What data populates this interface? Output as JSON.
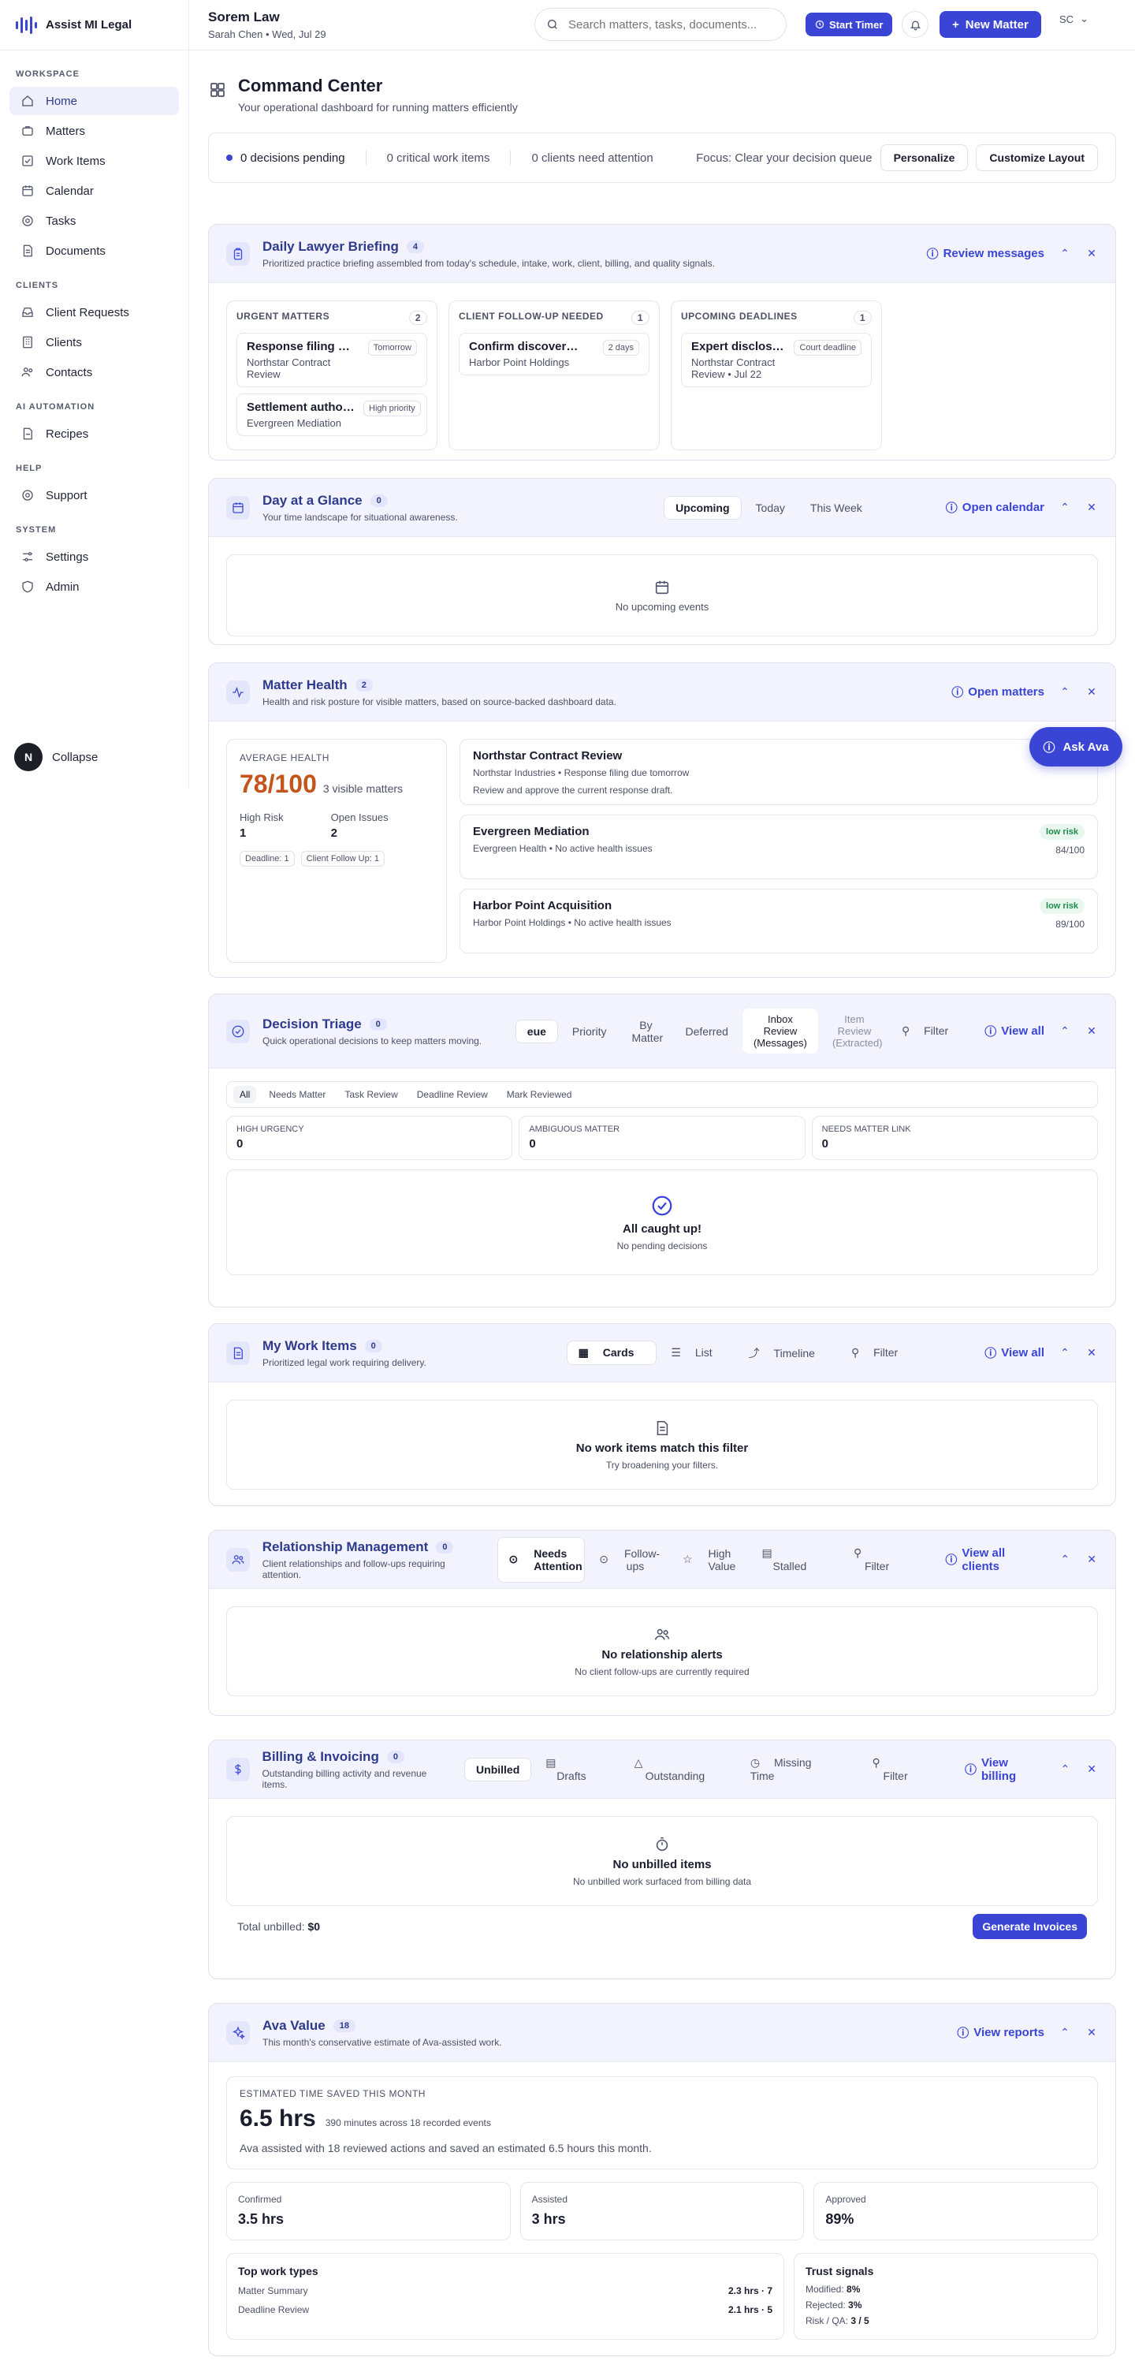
{
  "app": {
    "name": "Assist MI Legal",
    "firm": "Sorem Law",
    "user_line": "Sarah Chen • Wed, Jul 29",
    "initials": "SC"
  },
  "sidebar": {
    "sections": [
      {
        "label": "WORKSPACE",
        "items": [
          {
            "label": "Home",
            "icon": "home-icon"
          },
          {
            "label": "Matters",
            "icon": "briefcase-icon"
          },
          {
            "label": "Work Items",
            "icon": "checkbox-icon"
          },
          {
            "label": "Calendar",
            "icon": "calendar-icon"
          },
          {
            "label": "Tasks",
            "icon": "target-icon"
          },
          {
            "label": "Documents",
            "icon": "document-icon"
          }
        ]
      },
      {
        "label": "CLIENTS",
        "items": [
          {
            "label": "Client Requests",
            "icon": "inbox-icon"
          },
          {
            "label": "Clients",
            "icon": "building-icon"
          },
          {
            "label": "Contacts",
            "icon": "users-icon"
          }
        ]
      },
      {
        "label": "AI AUTOMATION",
        "items": [
          {
            "label": "Recipes",
            "icon": "recipe-icon"
          }
        ]
      },
      {
        "label": "HELP",
        "items": [
          {
            "label": "Support",
            "icon": "lifebuoy-icon"
          }
        ]
      },
      {
        "label": "SYSTEM",
        "items": [
          {
            "label": "Settings",
            "icon": "sliders-icon"
          },
          {
            "label": "Admin",
            "icon": "shield-icon"
          }
        ]
      }
    ],
    "collapse": "Collapse",
    "avatar": "N"
  },
  "topbar": {
    "search_placeholder": "Search matters, tasks, documents...",
    "timer": "Start Timer",
    "new_matter": "New Matter"
  },
  "command": {
    "title": "Command Center",
    "subtitle": "Your operational dashboard for running matters efficiently"
  },
  "status": {
    "decisions": "0 decisions pending",
    "critical": "0 critical work items",
    "clients": "0 clients need attention",
    "focus": "Focus: Clear your decision queue",
    "personalize": "Personalize",
    "customize": "Customize Layout"
  },
  "briefing": {
    "title": "Daily Lawyer Briefing",
    "count": "4",
    "subtitle": "Prioritized practice briefing assembled from today's schedule, intake, work, client, billing, and quality signals.",
    "action": "Review messages",
    "columns": [
      {
        "label": "URGENT MATTERS",
        "count": "2",
        "items": [
          {
            "title": "Response filing due tomorrow",
            "sub": "Northstar Contract Review",
            "tag": "Tomorrow"
          },
          {
            "title": "Settlement authority",
            "sub": "Evergreen Mediation",
            "tag": "High priority"
          }
        ]
      },
      {
        "label": "CLIENT FOLLOW-UP NEEDED",
        "count": "1",
        "items": [
          {
            "title": "Confirm discovery schedule",
            "sub": "Harbor Point Holdings",
            "tag": "2 days"
          }
        ]
      },
      {
        "label": "UPCOMING DEADLINES",
        "count": "1",
        "items": [
          {
            "title": "Expert disclosure",
            "sub": "Northstar Contract Review • Jul 22",
            "tag": "Court deadline"
          }
        ]
      }
    ]
  },
  "glance": {
    "title": "Day at a Glance",
    "count": "0",
    "subtitle": "Your time landscape for situational awareness.",
    "tabs": [
      "Upcoming",
      "Today",
      "This Week"
    ],
    "action": "Open calendar",
    "empty": "No upcoming events"
  },
  "health": {
    "title": "Matter Health",
    "count": "2",
    "subtitle": "Health and risk posture for visible matters, based on source-backed dashboard data.",
    "action": "Open matters",
    "avg_label": "AVERAGE HEALTH",
    "score": "78/100",
    "visible": "3 visible matters",
    "high_risk_label": "High Risk",
    "high_risk": "1",
    "open_issues_label": "Open Issues",
    "open_issues": "2",
    "chip1": "Deadline: 1",
    "chip2": "Client Follow Up: 1",
    "matters": [
      {
        "title": "Northstar Contract Review",
        "sub": "Northstar Industries • Response filing due tomorrow",
        "note": "Review and approve the current response draft."
      },
      {
        "title": "Evergreen Mediation",
        "sub": "Evergreen Health • No active health issues",
        "risk": "low risk",
        "score": "84/100"
      },
      {
        "title": "Harbor Point Acquisition",
        "sub": "Harbor Point Holdings • No active health issues",
        "risk": "low risk",
        "score": "89/100"
      }
    ]
  },
  "ask_ava": "Ask Ava",
  "triage": {
    "title": "Decision Triage",
    "count": "0",
    "subtitle": "Quick operational decisions to keep matters moving.",
    "tabs": [
      "eue",
      "Priority",
      "By Matter",
      "Deferred",
      "Inbox Review (Messages)",
      "Item Review (Extracted)"
    ],
    "filter": "Filter",
    "action": "View all",
    "subtabs": [
      "All",
      "Needs Matter",
      "Task Review",
      "Deadline Review",
      "Mark Reviewed"
    ],
    "stats": [
      {
        "label": "HIGH URGENCY",
        "value": "0"
      },
      {
        "label": "AMBIGUOUS MATTER",
        "value": "0"
      },
      {
        "label": "NEEDS MATTER LINK",
        "value": "0"
      }
    ],
    "empty_title": "All caught up!",
    "empty_sub": "No pending decisions"
  },
  "work": {
    "title": "My Work Items",
    "count": "0",
    "subtitle": "Prioritized legal work requiring delivery.",
    "tabs": [
      "Cards",
      "List",
      "Timeline"
    ],
    "filter": "Filter",
    "action": "View all",
    "empty_title": "No work items match this filter",
    "empty_sub": "Try broadening your filters."
  },
  "relations": {
    "title": "Relationship Management",
    "count": "0",
    "subtitle": "Client relationships and follow-ups requiring attention.",
    "tabs": [
      "Needs Attention",
      "Follow-ups",
      "High Value",
      "Stalled"
    ],
    "filter": "Filter",
    "action": "View all clients",
    "empty_title": "No relationship alerts",
    "empty_sub": "No client follow-ups are currently required"
  },
  "billing": {
    "title": "Billing & Invoicing",
    "count": "0",
    "subtitle": "Outstanding billing activity and revenue items.",
    "tabs": [
      "Unbilled",
      "Drafts",
      "Outstanding",
      "Missing Time"
    ],
    "filter": "Filter",
    "action": "View billing",
    "empty_title": "No unbilled items",
    "empty_sub": "No unbilled work surfaced from billing data",
    "total_label": "Total unbilled:",
    "total": "$0",
    "generate": "Generate Invoices"
  },
  "ava": {
    "title": "Ava Value",
    "count": "18",
    "subtitle": "This month's conservative estimate of Ava-assisted work.",
    "action": "View reports",
    "est_label": "ESTIMATED TIME SAVED THIS MONTH",
    "hours": "6.5 hrs",
    "minutes": "390 minutes across 18 recorded events",
    "summary": "Ava assisted with 18 reviewed actions and saved an estimated 6.5 hours this month.",
    "stats": [
      {
        "label": "Confirmed",
        "value": "3.5 hrs"
      },
      {
        "label": "Assisted",
        "value": "3 hrs"
      },
      {
        "label": "Approved",
        "value": "89%"
      }
    ],
    "top_label": "Top work types",
    "top": [
      {
        "name": "Matter Summary",
        "value": "2.3 hrs · 7"
      },
      {
        "name": "Deadline Review",
        "value": "2.1 hrs · 5"
      }
    ],
    "trust_label": "Trust signals",
    "trust": [
      {
        "name": "Modified:",
        "value": "8%"
      },
      {
        "name": "Rejected:",
        "value": "3%"
      },
      {
        "name": "Risk / QA:",
        "value": "3 / 5"
      }
    ]
  }
}
